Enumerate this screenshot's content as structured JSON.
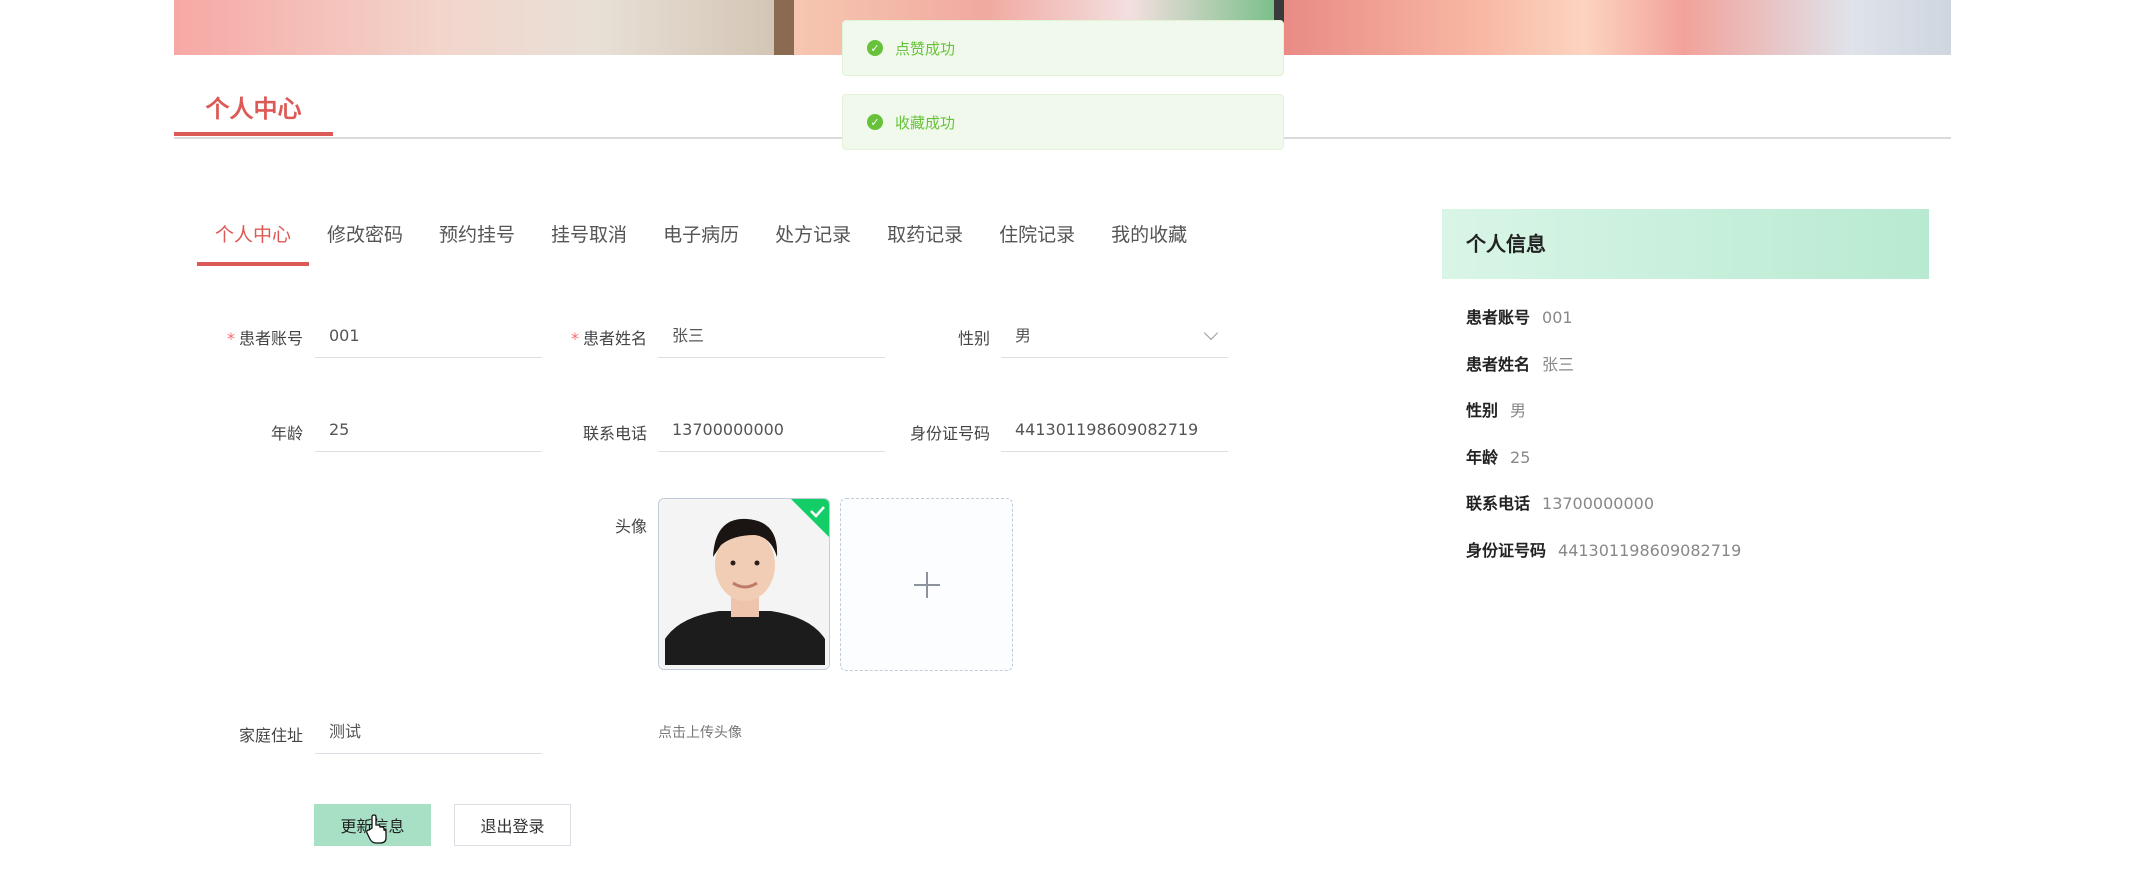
{
  "toasts": [
    {
      "text": "点赞成功"
    },
    {
      "text": "收藏成功"
    }
  ],
  "page_title": "个人中心",
  "tabs": [
    {
      "label": "个人中心",
      "active": true
    },
    {
      "label": "修改密码"
    },
    {
      "label": "预约挂号"
    },
    {
      "label": "挂号取消"
    },
    {
      "label": "电子病历"
    },
    {
      "label": "处方记录"
    },
    {
      "label": "取药记录"
    },
    {
      "label": "住院记录"
    },
    {
      "label": "我的收藏"
    }
  ],
  "form": {
    "account": {
      "label": "患者账号",
      "value": "001"
    },
    "name": {
      "label": "患者姓名",
      "value": "张三"
    },
    "gender": {
      "label": "性别",
      "value": "男"
    },
    "age": {
      "label": "年龄",
      "value": "25"
    },
    "phone": {
      "label": "联系电话",
      "value": "13700000000"
    },
    "id_card": {
      "label": "身份证号码",
      "value": "441301198609082719"
    },
    "avatar": {
      "label": "头像",
      "hint": "点击上传头像"
    },
    "address": {
      "label": "家庭住址",
      "value": "测试"
    },
    "required_mark": "*"
  },
  "buttons": {
    "update": "更新信息",
    "logout": "退出登录"
  },
  "panel": {
    "title": "个人信息",
    "rows": [
      {
        "key": "患者账号",
        "value": "001"
      },
      {
        "key": "患者姓名",
        "value": "张三"
      },
      {
        "key": "性别",
        "value": "男"
      },
      {
        "key": "年龄",
        "value": "25"
      },
      {
        "key": "联系电话",
        "value": "13700000000"
      },
      {
        "key": "身份证号码",
        "value": "441301198609082719"
      }
    ]
  },
  "colors": {
    "accent": "#dc5a55",
    "success": "#67c23a",
    "update_button": "#a8e0c6"
  }
}
